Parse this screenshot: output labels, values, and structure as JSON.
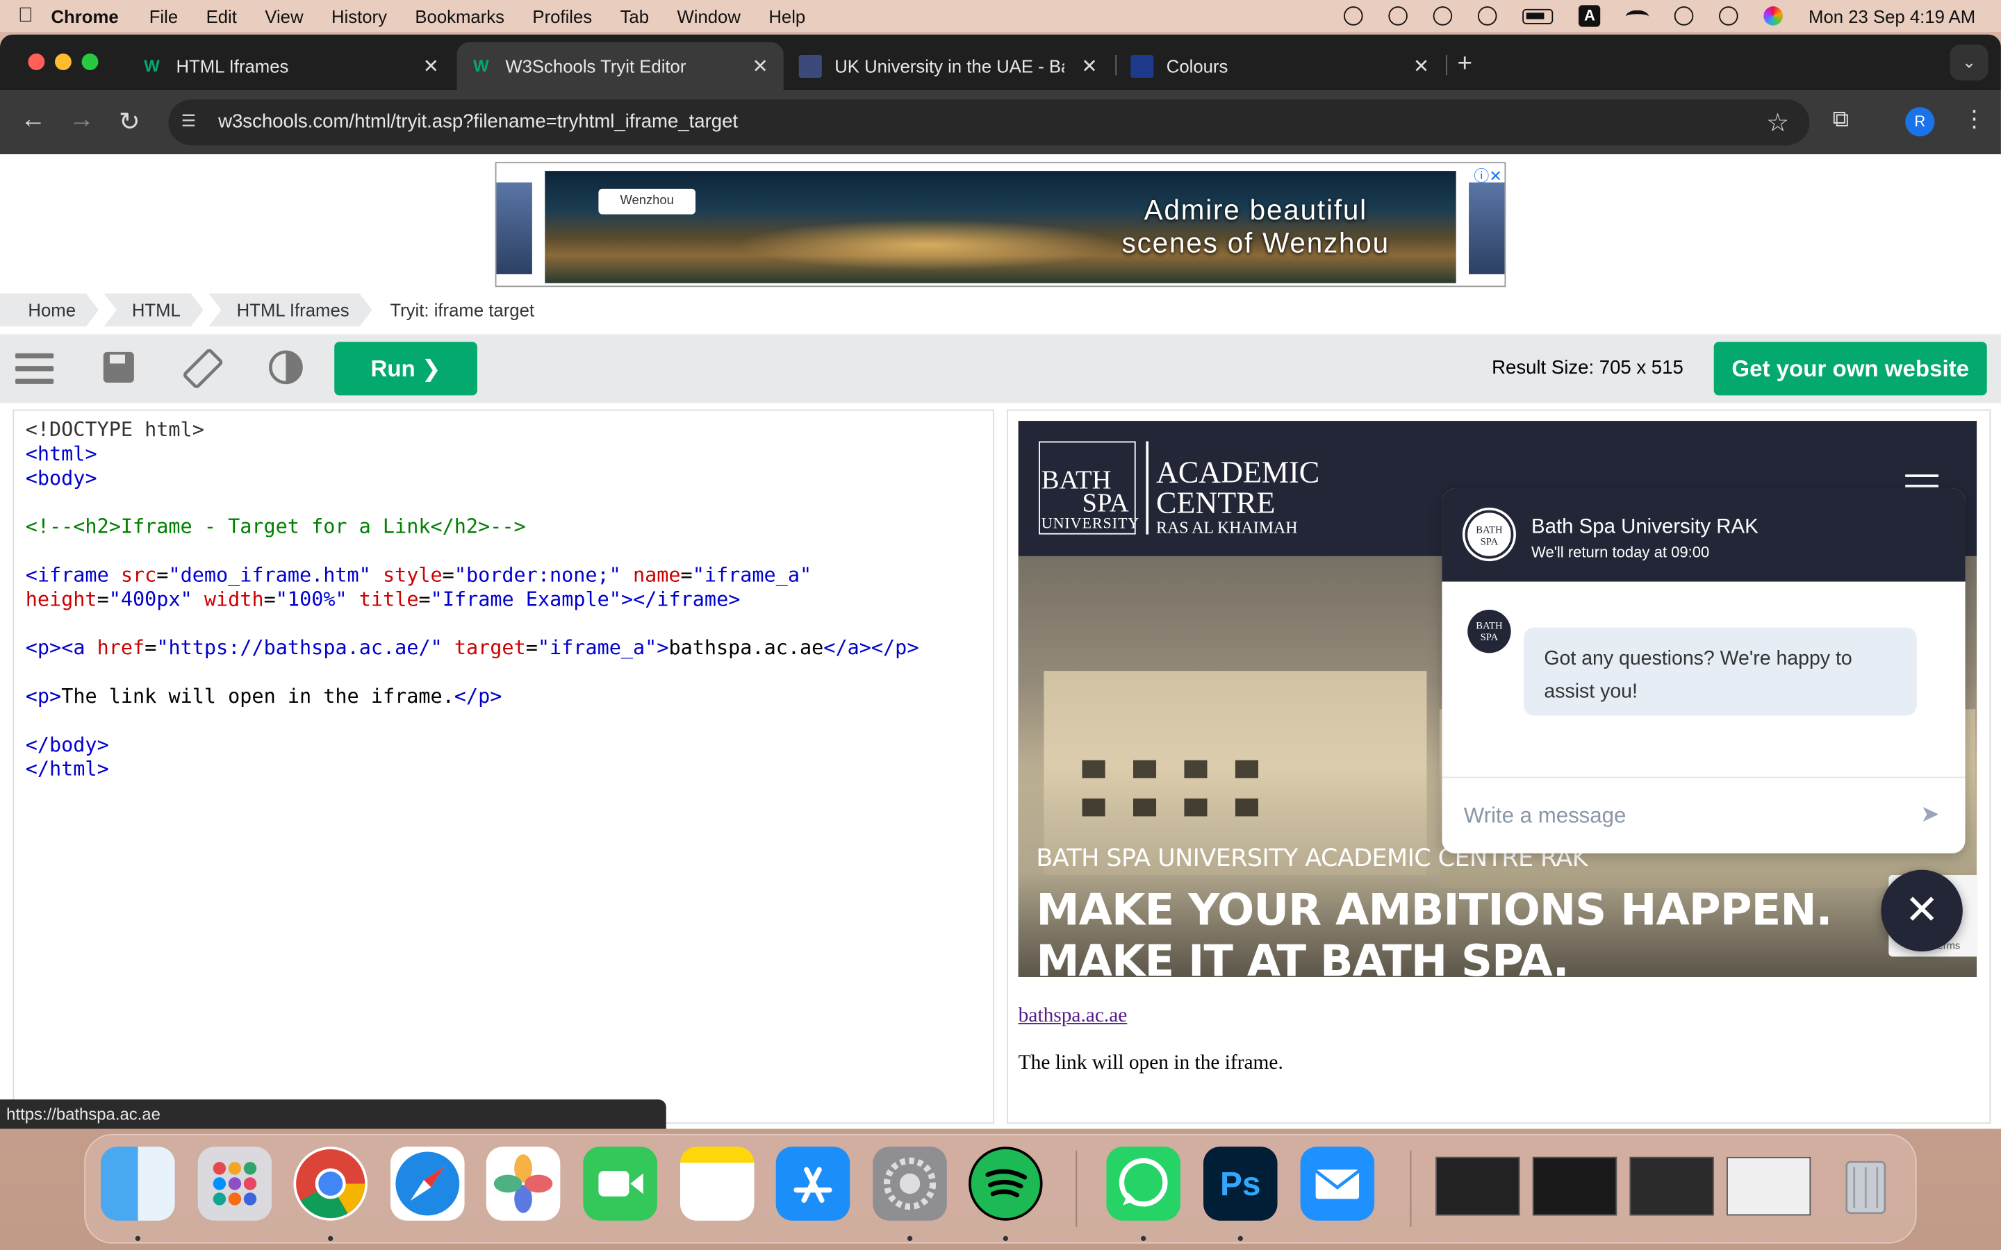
{
  "menubar": {
    "app_name": "Chrome",
    "items": [
      "File",
      "Edit",
      "View",
      "History",
      "Bookmarks",
      "Profiles",
      "Tab",
      "Window",
      "Help"
    ],
    "status_letter": "A",
    "clock": "Mon 23 Sep  4:19 AM"
  },
  "browser": {
    "tabs": [
      {
        "title": "HTML Iframes",
        "favicon": "W",
        "active": false
      },
      {
        "title": "W3Schools Tryit Editor",
        "favicon": "W",
        "active": true
      },
      {
        "title": "UK University in the UAE - Ba",
        "favicon": "BATH SPA",
        "active": false
      },
      {
        "title": "Colours",
        "favicon": "",
        "active": false
      }
    ],
    "new_tab_glyph": "+",
    "tab_menu_glyph": "⌄",
    "url": "w3schools.com/html/tryit.asp?filename=tryhtml_iframe_target",
    "profile_initial": "R",
    "status_url": "https://bathspa.ac.ae"
  },
  "ad": {
    "pin_label": "Wenzhou",
    "headline_1": "Admire beautiful",
    "headline_2": "scenes of Wenzhou"
  },
  "breadcrumb": [
    "Home",
    "HTML",
    "HTML Iframes",
    "Tryit: iframe target"
  ],
  "editor_toolbar": {
    "run_label": "Run ❯",
    "result_size": "Result Size: 705 x 515",
    "get_website_label": "Get your own website"
  },
  "code_lines": [
    "<!DOCTYPE html>",
    "<html>",
    "<body>",
    "",
    "<!--<h2>Iframe - Target for a Link</h2>-->",
    "",
    "<iframe src=\"demo_iframe.htm\" style=\"border:none;\" name=\"iframe_a\"",
    "height=\"400px\" width=\"100%\" title=\"Iframe Example\"></iframe>",
    "",
    "<p><a href=\"https://bathspa.ac.ae/\" target=\"iframe_a\">bathspa.ac.ae</a></p>",
    "",
    "<p>The link will open in the iframe.</p>",
    "",
    "</body>",
    "</html>"
  ],
  "result": {
    "logo": {
      "bath": "BATH",
      "spa": "SPA",
      "university": "UNIVERSITY",
      "academic": "ACADEMIC",
      "centre": "CENTRE",
      "location": "RAS AL KHAIMAH"
    },
    "hero_subtitle": "BATH SPA UNIVERSITY ACADEMIC CENTRE RAK",
    "hero_line1": "MAKE YOUR AMBITIONS HAPPEN.",
    "hero_line2": "MAKE IT AT BATH SPA.",
    "chat": {
      "name": "Bath Spa University RAK",
      "subtitle": "We'll return today at 09:00",
      "message": "Got any questions? We're happy to assist you!",
      "input_placeholder": "Write a message"
    },
    "recaptcha_terms": "Terms",
    "link_text": "bathspa.ac.ae",
    "paragraph": "The link will open in the iframe."
  },
  "dock": {
    "apps": [
      "Finder",
      "Launchpad",
      "Chrome",
      "Safari",
      "Photos",
      "FaceTime",
      "Notes",
      "App Store",
      "System Settings",
      "Spotify",
      "WhatsApp",
      "Photoshop",
      "Mail"
    ],
    "photoshop_label": "Ps"
  },
  "colors": {
    "w3_green": "#04aa6d",
    "bathspa_navy": "#232637",
    "chrome_dark": "#1f1f1f"
  }
}
